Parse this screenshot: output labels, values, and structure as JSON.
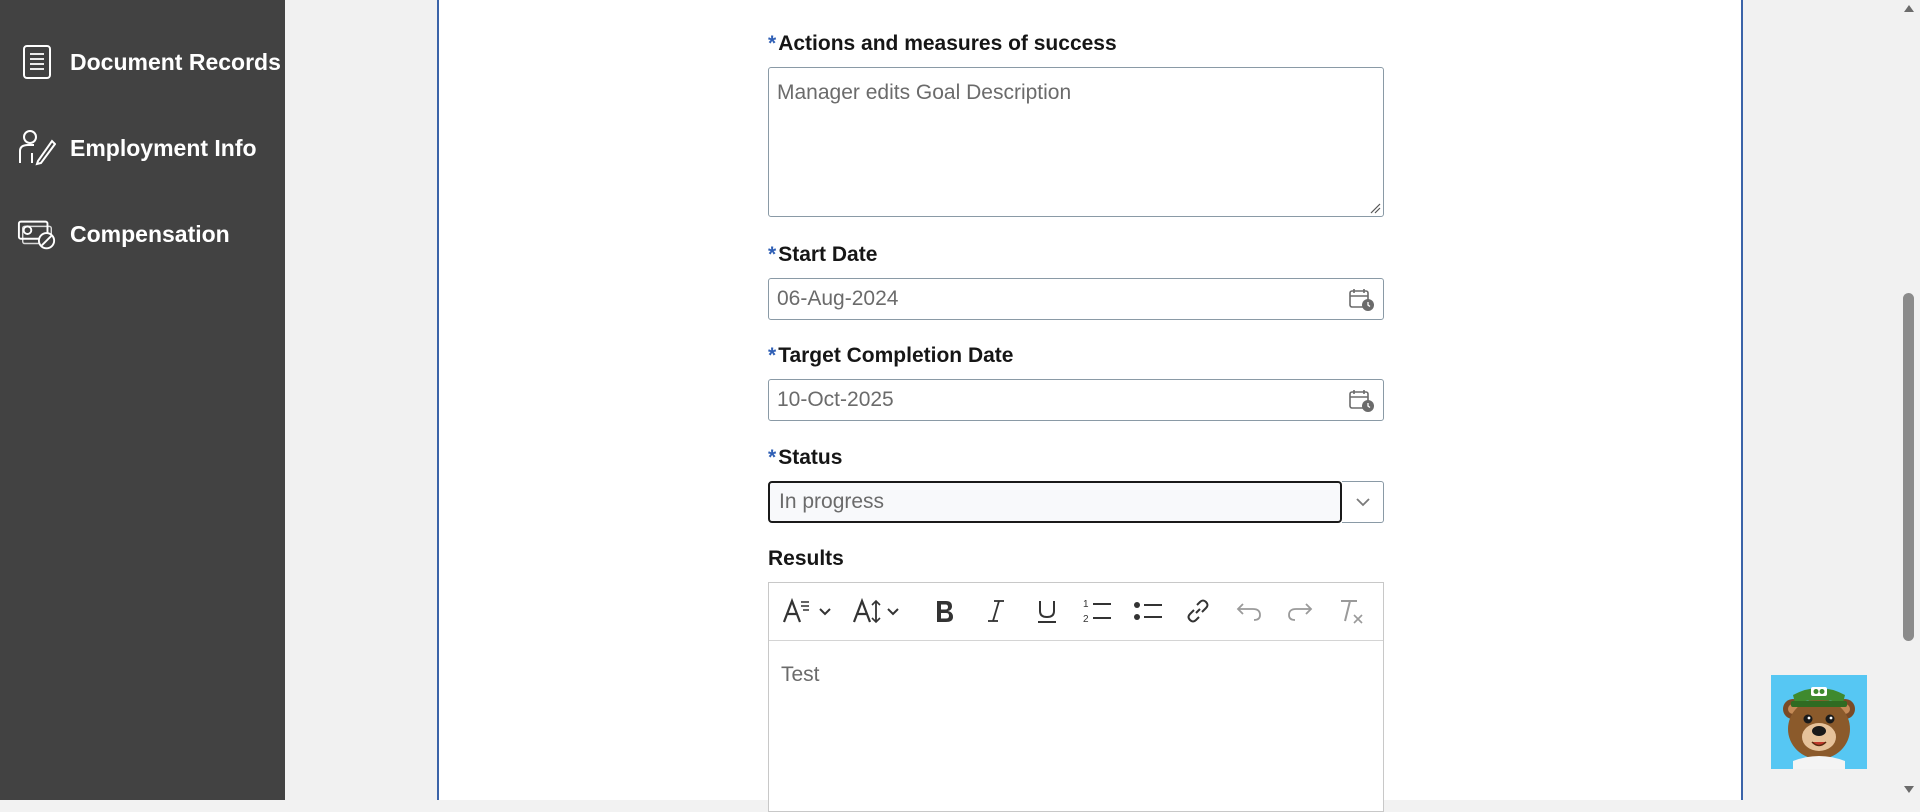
{
  "sidebar": {
    "items": [
      {
        "label": "Document Records",
        "icon": "document-list-icon"
      },
      {
        "label": "Employment Info",
        "icon": "person-edit-icon"
      },
      {
        "label": "Compensation",
        "icon": "money-icon"
      }
    ]
  },
  "form": {
    "required_marker": "*",
    "actions": {
      "label": "Actions and measures of success",
      "placeholder": "Manager edits Goal Description"
    },
    "start_date": {
      "label": "Start Date",
      "value": "06-Aug-2024"
    },
    "target_date": {
      "label": "Target Completion Date",
      "value": "10-Oct-2025"
    },
    "status": {
      "label": "Status",
      "value": "In progress"
    },
    "results": {
      "label": "Results",
      "value": "Test"
    }
  },
  "colors": {
    "sidebar_bg": "#424242",
    "required_marker": "#2f5fb5",
    "panel_border": "#3b63a8",
    "mascot_bg": "#56c7f3"
  }
}
